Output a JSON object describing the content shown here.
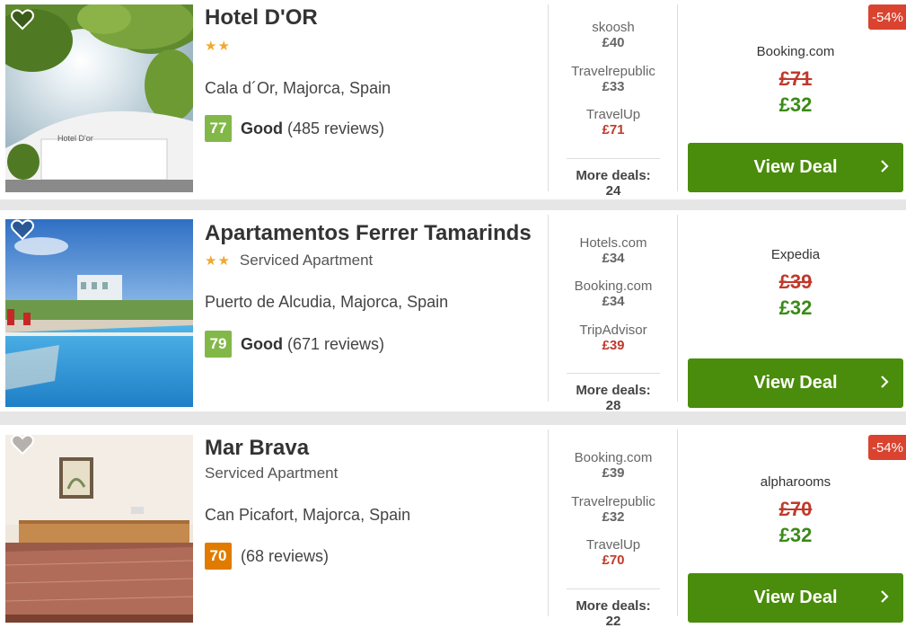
{
  "hotels": [
    {
      "name": "Hotel D'OR",
      "stars": "★★",
      "type": "",
      "location": "Cala d´Or, Majorca, Spain",
      "score": "77",
      "rating_word": "Good",
      "reviews": "(485 reviews)",
      "deals": [
        {
          "provider": "skoosh",
          "price": "£40"
        },
        {
          "provider": "Travelrepublic",
          "price": "£33"
        },
        {
          "provider": "TravelUp",
          "price": "£71"
        }
      ],
      "more_deals": "More deals: 24",
      "discount": "-54%",
      "best_provider": "Booking.com",
      "old_price": "£71",
      "new_price": "£32",
      "button": "View Deal",
      "photo_sign": "Hotel D'or"
    },
    {
      "name": "Apartamentos Ferrer Tamarinds",
      "stars": "★★",
      "type": "Serviced Apartment",
      "location": "Puerto de Alcudia, Majorca, Spain",
      "score": "79",
      "rating_word": "Good",
      "reviews": "(671 reviews)",
      "deals": [
        {
          "provider": "Hotels.com",
          "price": "£34"
        },
        {
          "provider": "Booking.com",
          "price": "£34"
        },
        {
          "provider": "TripAdvisor",
          "price": "£39"
        }
      ],
      "more_deals": "More deals: 28",
      "discount": "",
      "best_provider": "Expedia",
      "old_price": "£39",
      "new_price": "£32",
      "button": "View Deal",
      "photo_sign": ""
    },
    {
      "name": "Mar Brava",
      "stars": "",
      "type": "Serviced Apartment",
      "location": "Can Picafort, Majorca, Spain",
      "score": "70",
      "rating_word": "",
      "reviews": "(68 reviews)",
      "deals": [
        {
          "provider": "Booking.com",
          "price": "£39"
        },
        {
          "provider": "Travelrepublic",
          "price": "£32"
        },
        {
          "provider": "TravelUp",
          "price": "£70"
        }
      ],
      "more_deals": "More deals: 22",
      "discount": "-54%",
      "best_provider": "alpharooms",
      "old_price": "£70",
      "new_price": "£32",
      "button": "View Deal",
      "photo_sign": ""
    }
  ],
  "colors": {
    "button_green": "#4a8c0b",
    "price_green": "#3a8b16",
    "price_red": "#c0392b",
    "score_good": "#82b848",
    "score_ok": "#e07b00",
    "badge_red": "#d9432f",
    "star_gold": "#f0a830"
  }
}
